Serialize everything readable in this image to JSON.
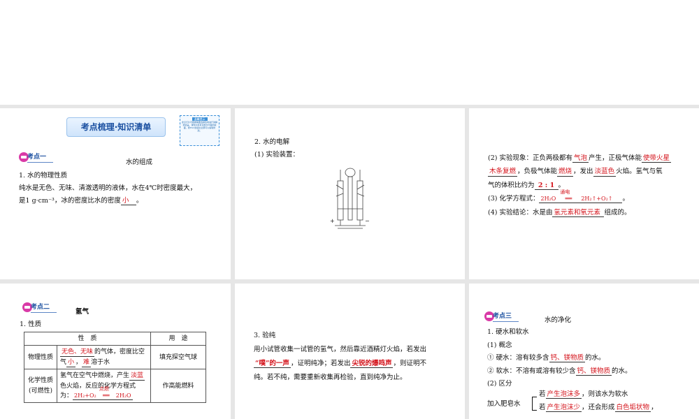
{
  "slide1": {
    "banner": "考点梳理·知识清单",
    "tip_title": "温馨提示",
    "tip_text": "此幻灯片可根据需要选择性地进行讲解或遮盖，课件中另有该部分内容的版面，按ESC键退出全屏可以编辑修改。",
    "kaodian": "考点一",
    "heading": "水的组成",
    "p1_title": "1. 水的物理性质",
    "p2": "纯水是无色、无味、清澈透明的液体，水在4℃时密度最大，",
    "p3_a": "是1 g·cm⁻³，冰的密度比水的密度",
    "p3_ans": "小",
    "p3_b": "。"
  },
  "slide2": {
    "title": "2. 水的电解",
    "sub": "(1) 实验装置：",
    "plus": "+",
    "minus": "−"
  },
  "slide3": {
    "l1_a": "(2) 实验现象：正负两极都有",
    "l1_ans1": "气泡",
    "l1_b": "产生，正极气体能",
    "l1_ans2": "使带火星",
    "l2_ans2b": "木条复燃",
    "l2_a": "，负极气体能",
    "l2_ans3": "燃烧",
    "l2_b": "，发出",
    "l2_ans4": "淡蓝色",
    "l2_c": "火焰。氢气与氧",
    "l3_a": "气的体积比约为",
    "l3_ans": "2 : 1",
    "l3_b": "。",
    "l4_a": "(3) 化学方程式：",
    "eq_left": "2H₂O",
    "eq_cond": "通电",
    "eq_right": "2H₂↑+O₂↑",
    "l4_b": "。",
    "l5_a": "(4) 实验结论：水是由",
    "l5_ans": "氢元素和氧元素",
    "l5_b": "组成的。"
  },
  "slide4": {
    "kaodian": "考点二",
    "heading": "氢气",
    "p1": "1. 性质",
    "table": {
      "head_prop": "性　质",
      "head_use": "用　途",
      "r1_label": "物理性质",
      "r1_ans1": "无色、无味",
      "r1_t1": "的气体，密度比",
      "r1_t2": "空气",
      "r1_ans2": "小",
      "r1_t3": "，",
      "r1_ans3": "难",
      "r1_t4": "溶于水",
      "r1_use": "填充探空气球",
      "r2_label": "化学性质(可燃性)",
      "r2_t1": "氢气在空气中燃烧，产生",
      "r2_ans1": "淡蓝",
      "r2_t2": "色火焰，反应的化学方程式为：",
      "r2_eq_left": "2H₂+O₂",
      "r2_eq_cond": "点燃",
      "r2_eq_right": "2H₂O",
      "r2_use": "作高能燃料"
    }
  },
  "slide5": {
    "title": "3. 验纯",
    "l1": "用小试管收集一试管的氢气，然后靠近酒精灯火焰，若发出",
    "ans1": "“噗”的一声",
    "l2_a": "，证明纯净；若发出",
    "ans2": "尖锐的爆鸣声",
    "l2_b": "，则证明不",
    "l3": "纯。若不纯，需要重新收集再检验，直到纯净为止。"
  },
  "slide6": {
    "kaodian": "考点三",
    "heading": "水的净化",
    "p1": "1. 硬水和软水",
    "p2": "(1) 概念",
    "p3_a": "① 硬水：溶有较多含",
    "p3_ans": "钙、镁物质",
    "p3_b": "的水。",
    "p4_a": "② 软水：不溶有或溶有较少含",
    "p4_ans": "钙、镁物质",
    "p4_b": "的水。",
    "p5": "(2) 区分",
    "method": "加入肥皂水",
    "b1_a": "若",
    "b1_ans": "产生泡沫多",
    "b1_b": "，则该水为软水",
    "b2_a": "若",
    "b2_ans": "产生泡沫少",
    "b2_b": "，还会形成",
    "b2_ans2": "白色垢状物",
    "b2_c": "，"
  },
  "colors": {
    "answer": "#d4141c",
    "heading_blue": "#1a4fa0",
    "icon_pink": "#d93aa7"
  }
}
